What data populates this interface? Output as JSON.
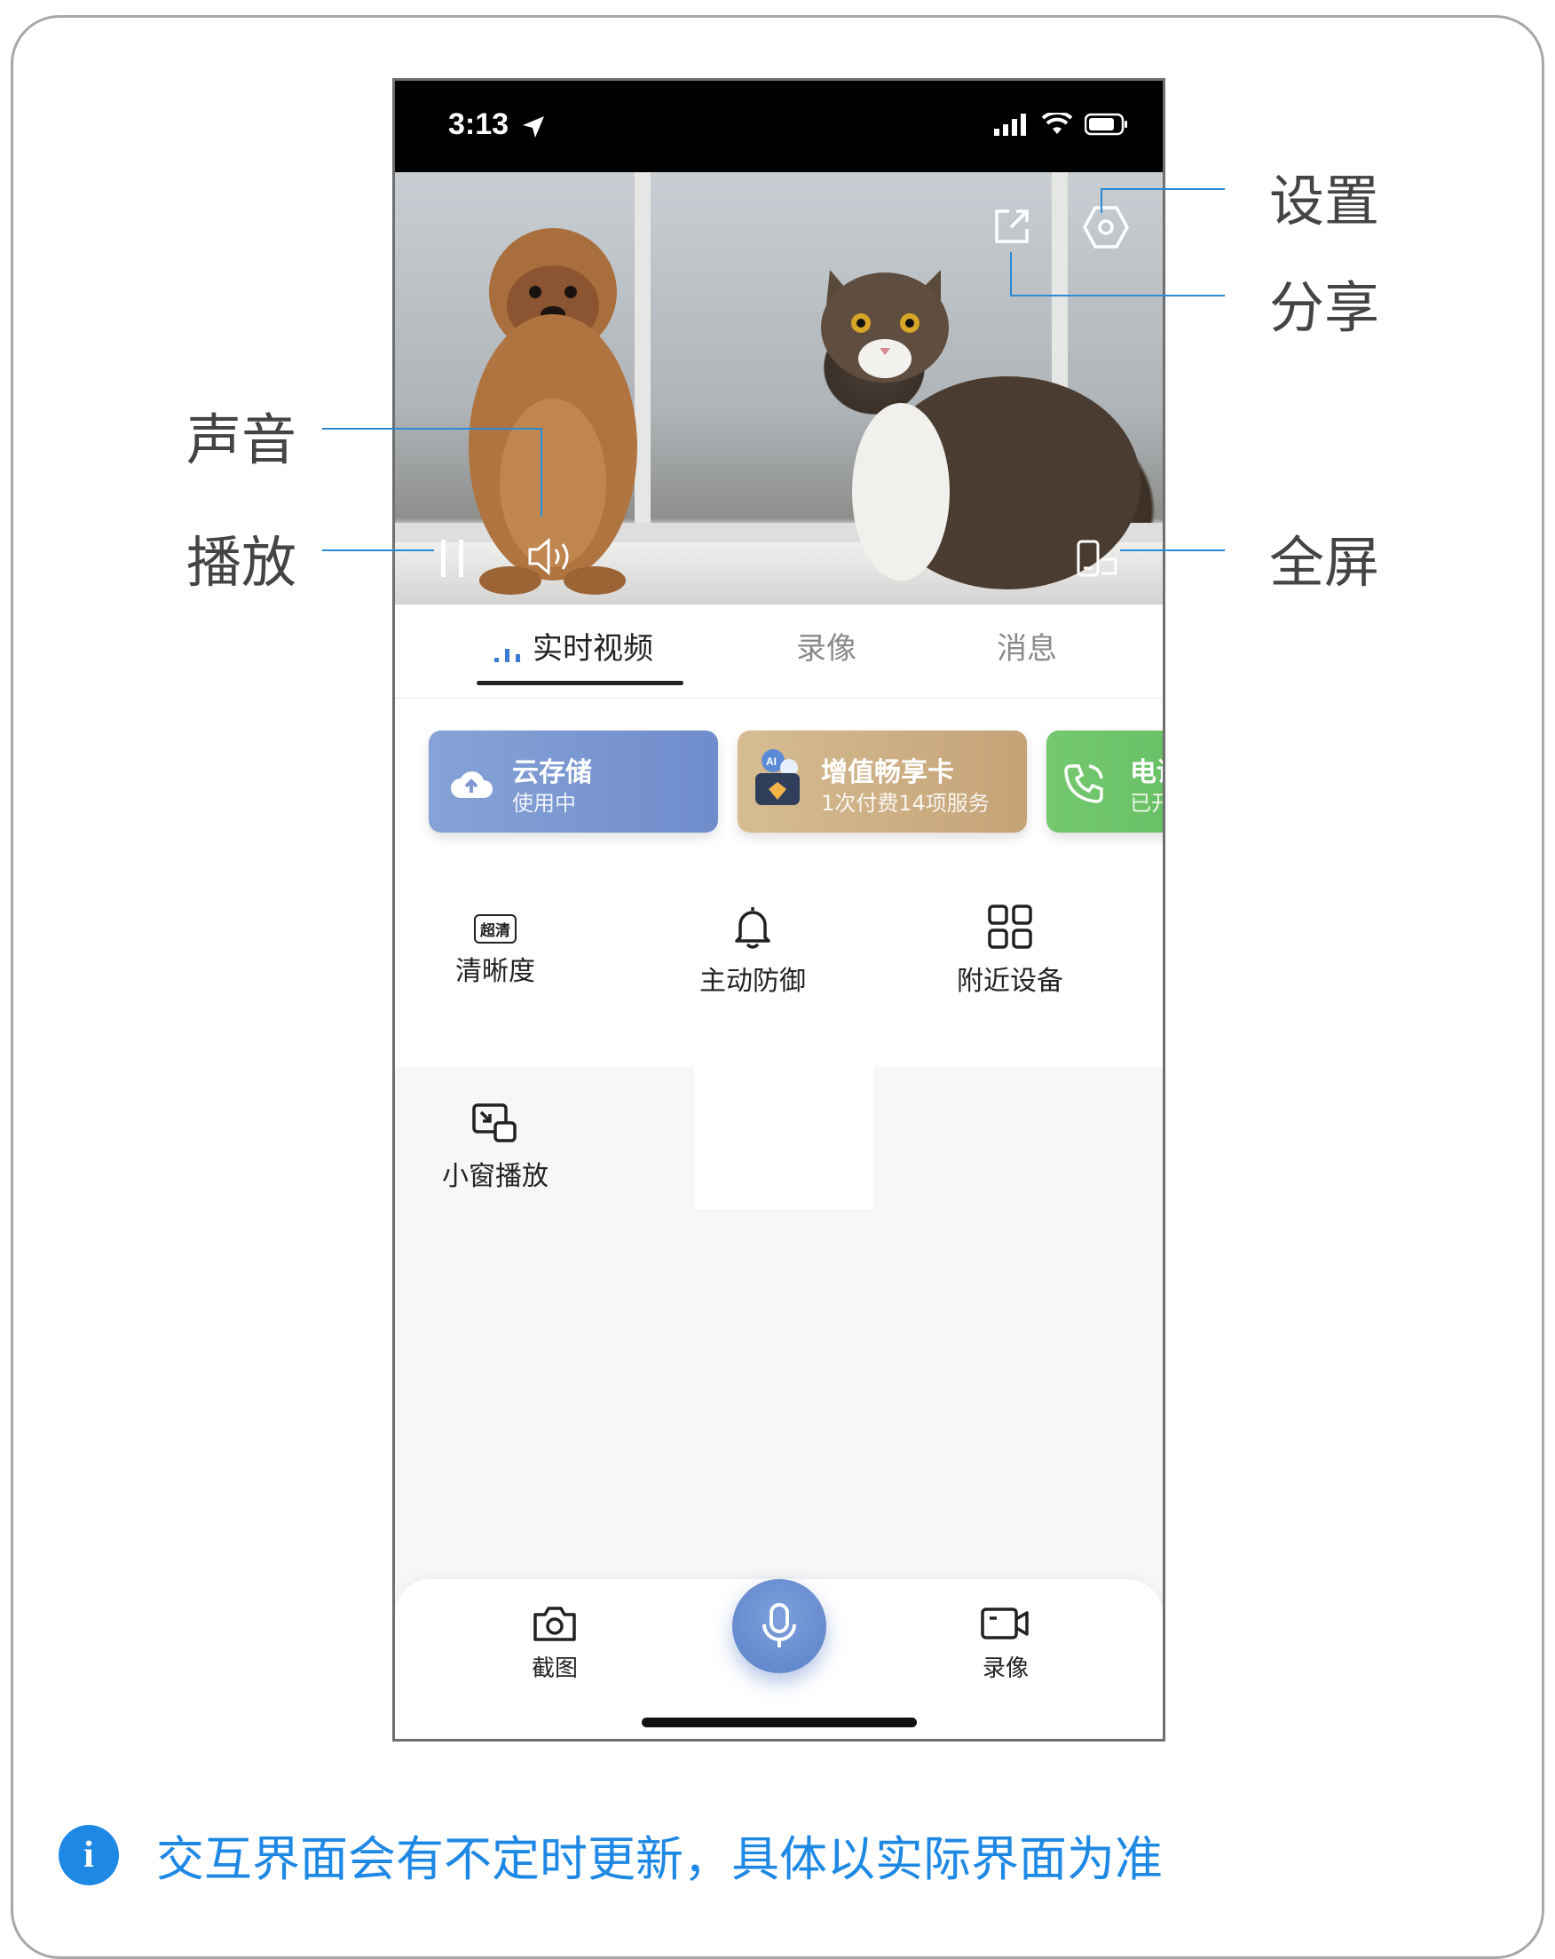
{
  "status_bar": {
    "time": "3:13"
  },
  "tabs": {
    "live": "实时视频",
    "recording": "录像",
    "messages": "消息"
  },
  "services": {
    "cloud": {
      "title": "云存储",
      "subtitle": "使用中",
      "color": "#7f9ad2"
    },
    "vip": {
      "title": "增值畅享卡",
      "subtitle": "1次付费14项服务",
      "color": "#c9aa7e"
    },
    "phone": {
      "title": "电话",
      "subtitle": "已开",
      "color": "#6cc16a"
    }
  },
  "controls": {
    "quality": {
      "badge": "超清",
      "label": "清晰度"
    },
    "defense": {
      "label": "主动防御"
    },
    "nearby": {
      "label": "附近设备"
    },
    "pip": {
      "label": "小窗播放"
    }
  },
  "bottom_bar": {
    "screenshot": "截图",
    "record": "录像"
  },
  "callouts": {
    "settings": "设置",
    "share": "分享",
    "sound": "声音",
    "play": "播放",
    "fullscreen": "全屏"
  },
  "note": {
    "icon": "i",
    "text": "交互界面会有不定时更新，具体以实际界面为准"
  },
  "colors": {
    "accent": "#1e88e5",
    "callout_line": "#2a8bd6",
    "mic": "#5b80c8"
  }
}
